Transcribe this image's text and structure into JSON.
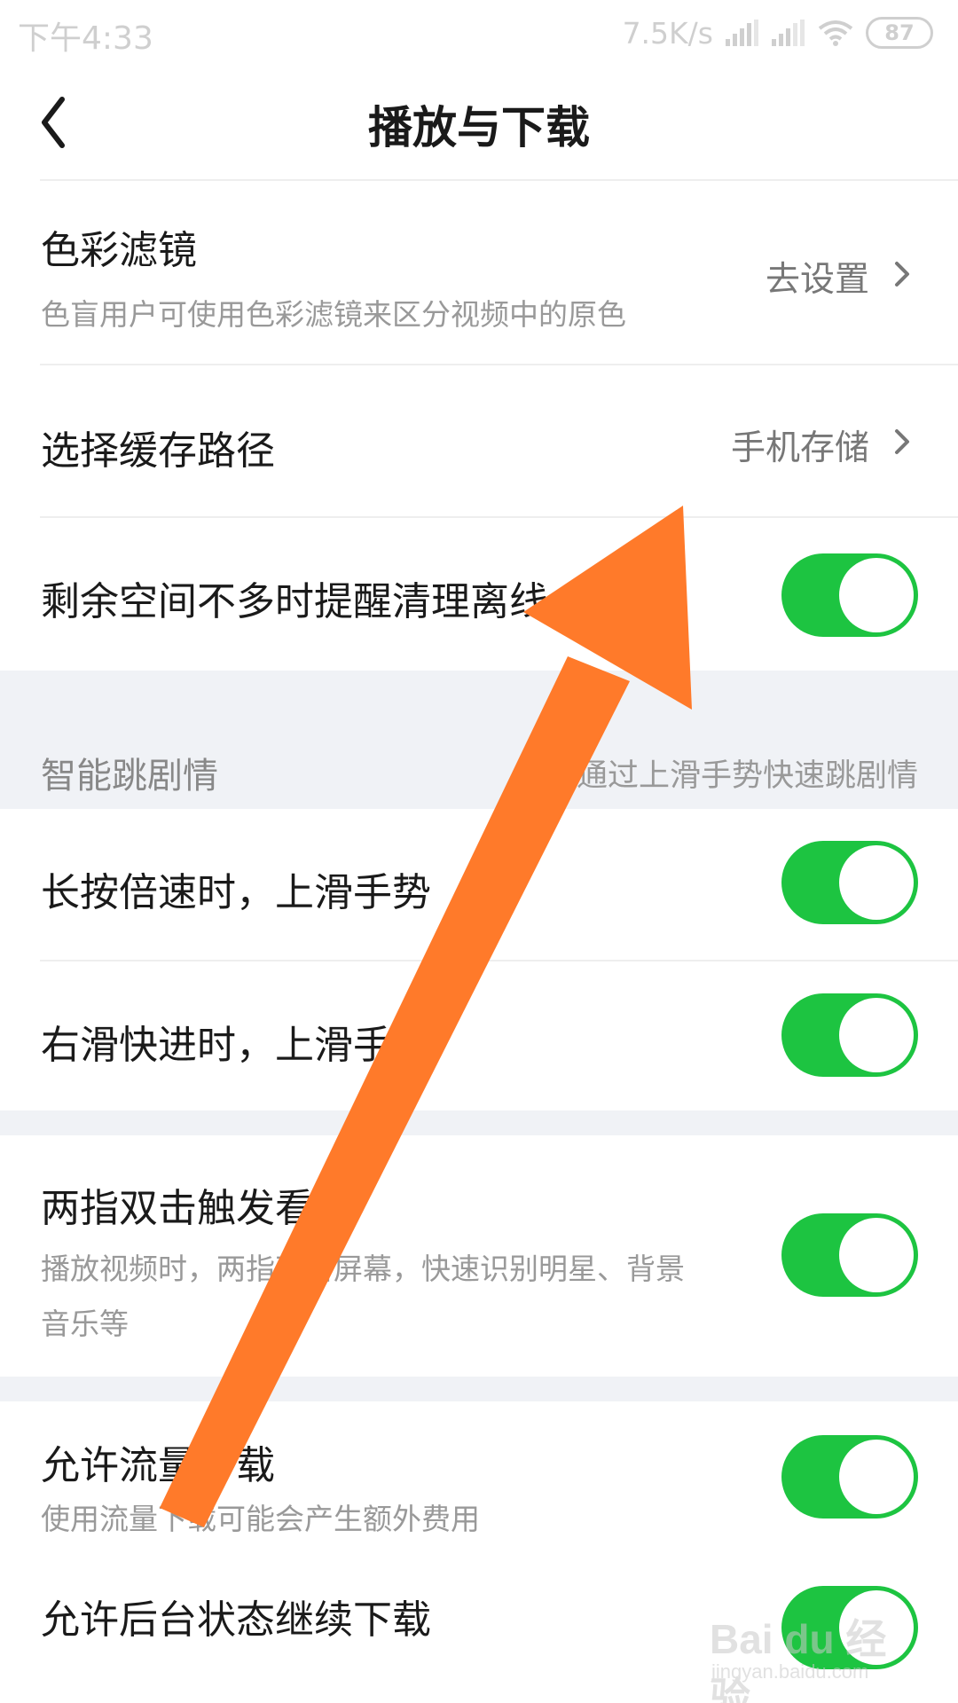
{
  "status": {
    "time": "下午4:33",
    "network_speed": "7.5K/s",
    "battery": "87"
  },
  "nav": {
    "back_icon": "chevron-left-icon",
    "title": "播放与下载"
  },
  "color_filter": {
    "title": "色彩滤镜",
    "subtitle": "色盲用户可使用色彩滤镜来区分视频中的原色",
    "action": "去设置"
  },
  "cache_path": {
    "title": "选择缓存路径",
    "value": "手机存储"
  },
  "low_space_reminder": {
    "title": "剩余空间不多时提醒清理离线",
    "enabled": true
  },
  "smart_skip": {
    "section_title": "智能跳剧情",
    "section_note": "通过上滑手势快速跳剧情"
  },
  "long_press_swipe": {
    "title": "长按倍速时，上滑手势",
    "enabled": true
  },
  "right_swipe_gesture": {
    "title": "右滑快进时，上滑手势",
    "enabled": true
  },
  "two_finger_tap": {
    "title": "两指双击触发看视",
    "subtitle_line1": "播放视频时，两指双击屏幕，快速识别明星、背景",
    "subtitle_line2": "音乐等",
    "enabled": true
  },
  "mobile_data_download": {
    "title": "允许流量下载",
    "subtitle": "使用流量下载可能会产生额外费用",
    "enabled": true
  },
  "background_download": {
    "title": "允许后台状态继续下载",
    "enabled": true
  },
  "watermark": {
    "logo": "Bai du 经验",
    "url": "jingyan.baidu.com"
  },
  "colors": {
    "toggle_on": "#1dc441",
    "annotation_arrow": "#ff7a2a",
    "section_background": "#f0f2f6"
  }
}
